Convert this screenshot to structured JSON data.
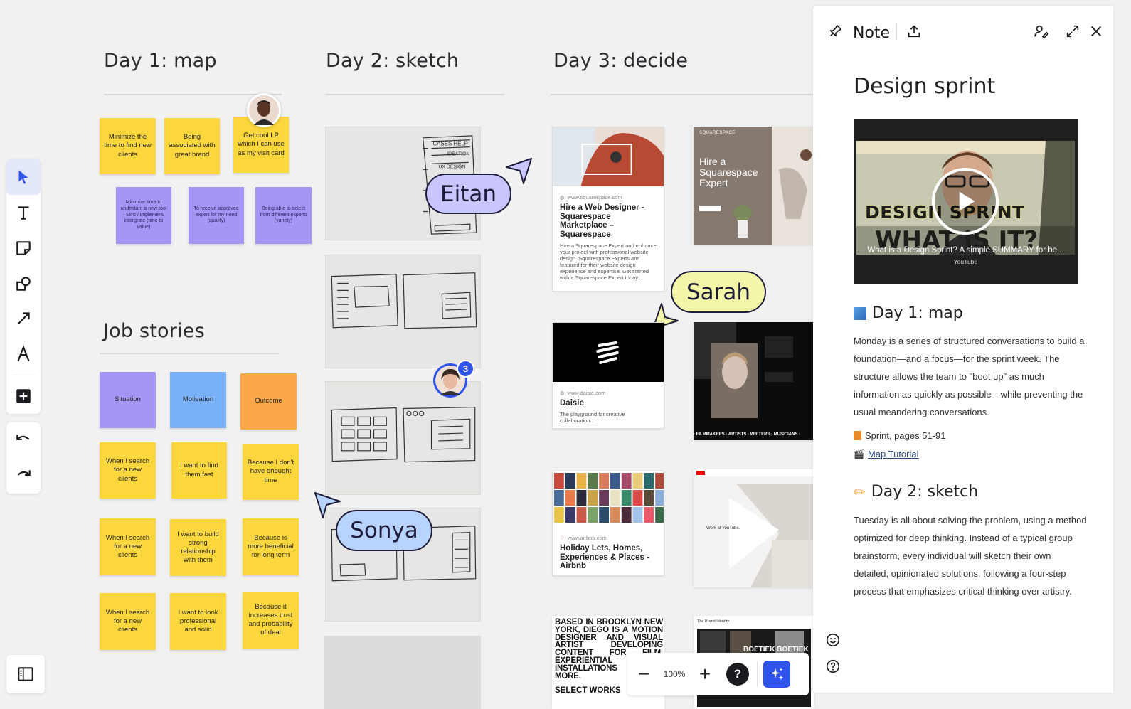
{
  "sections": {
    "day1": "Day 1: map",
    "day2": "Day 2: sketch",
    "day3": "Day 3: decide",
    "jobs": "Job stories"
  },
  "day1_notes": {
    "yellow": [
      "Minimize the time to find new clients",
      "Being associated with great brand",
      "Get cool LP which I can use as my visit card"
    ],
    "purple": [
      "Minimize time to undestant a new tool - Miro / implement/ intergrate (time to value)",
      "To receive approved expert for my need (quality)",
      "Being able to select from different experts (variety)"
    ]
  },
  "job_stories": {
    "headers": [
      "Situation",
      "Motivation",
      "Outcome"
    ],
    "rows": [
      [
        "When I search for a new clients",
        "I want to find them fast",
        "Because I don't have enought time"
      ],
      [
        "When I search for a new clients",
        "I want to build strong relationship with them",
        "Because is more beneficial for long term"
      ],
      [
        "When I search for a new clients",
        "I want to look professional and solid",
        "Because it increases trust and probability of deal"
      ]
    ]
  },
  "cursors": {
    "eitan": "Eitan",
    "sarah": "Sarah",
    "sonya": "Sonya",
    "avatar_badge": "3"
  },
  "cards": {
    "squarespace": {
      "url": "www.squarespace.com",
      "title": "Hire a Web Designer - Squarespace Marketplace – Squarespace",
      "desc": "Hire a Squarespace Expert and enhance your project with professional website design. Squarespace Experts are featured for their website design experience and expertise. Get started with a Squarespace Expert today...."
    },
    "squarespace_tile": {
      "brand": "SQUARESPACE",
      "headline": "Hire a Squarespace Expert"
    },
    "daisie": {
      "url": "www.daisie.com",
      "title": "Daisie",
      "desc": "The playground for creative collaboration..."
    },
    "daisie_tile": {
      "footer": "· FILMMAKERS · ARTISTS · WRITERS · MUSICIANS ·"
    },
    "airbnb": {
      "url": "www.airbnb.com",
      "title": "Holiday Lets, Homes, Experiences & Places - Airbnb"
    },
    "youtube_tile": {
      "caption": "Work at YouTube."
    },
    "diego_tile": {
      "text": "BASED IN BROOKLYN NEW YORK, DIEGO IS A MOTION DESIGNER AND VISUAL ARTIST DEVELOPING CONTENT FOR FILM, EXPERIENTIAL EVENTS, INSTALLATIONS AND MORE.",
      "more": "SELECT WORKS"
    },
    "brand_tile": {
      "label": "The Brand Identity",
      "sign": "BOETIEK BOETIEK BO"
    }
  },
  "zoom": {
    "value": "100%",
    "help": "?"
  },
  "panel": {
    "header_title": "Note",
    "doc_title": "Design sprint",
    "video": {
      "title": "What is a Design Sprint? A simple SUMMARY for be...",
      "source": "YouTube",
      "thumb_text_1": "DESIGN SPRINT",
      "thumb_text_2": "WHAT IS IT?"
    },
    "day1": {
      "heading": "Day 1: map",
      "body": "Monday is a series of structured conversations to build a foundation—and a focus—for the sprint week. The structure allows the team to \"boot up\" as much information as quickly as possible—while preventing the usual meandering conversations.",
      "ref1": "Sprint, pages 51-91",
      "ref2": "Map Tutorial"
    },
    "day2": {
      "heading": "Day 2: sketch",
      "body": "Tuesday is all about solving the problem, using a method optimized for deep thinking. Instead of a typical group brainstorm, every individual will sketch their own detailed, opinionated solutions, following a four-step process that emphasizes critical thinking over artistry."
    }
  },
  "colors": {
    "accent": "#2f54eb",
    "sticky_yellow": "#fbd73d",
    "sticky_purple": "#a596f5",
    "sticky_blue": "#7ab0f7",
    "sticky_orange": "#fba84a",
    "cursor_purple": "#c9c6ff",
    "cursor_yellow": "#f3f5a8",
    "cursor_blue": "#b9d3ff"
  }
}
